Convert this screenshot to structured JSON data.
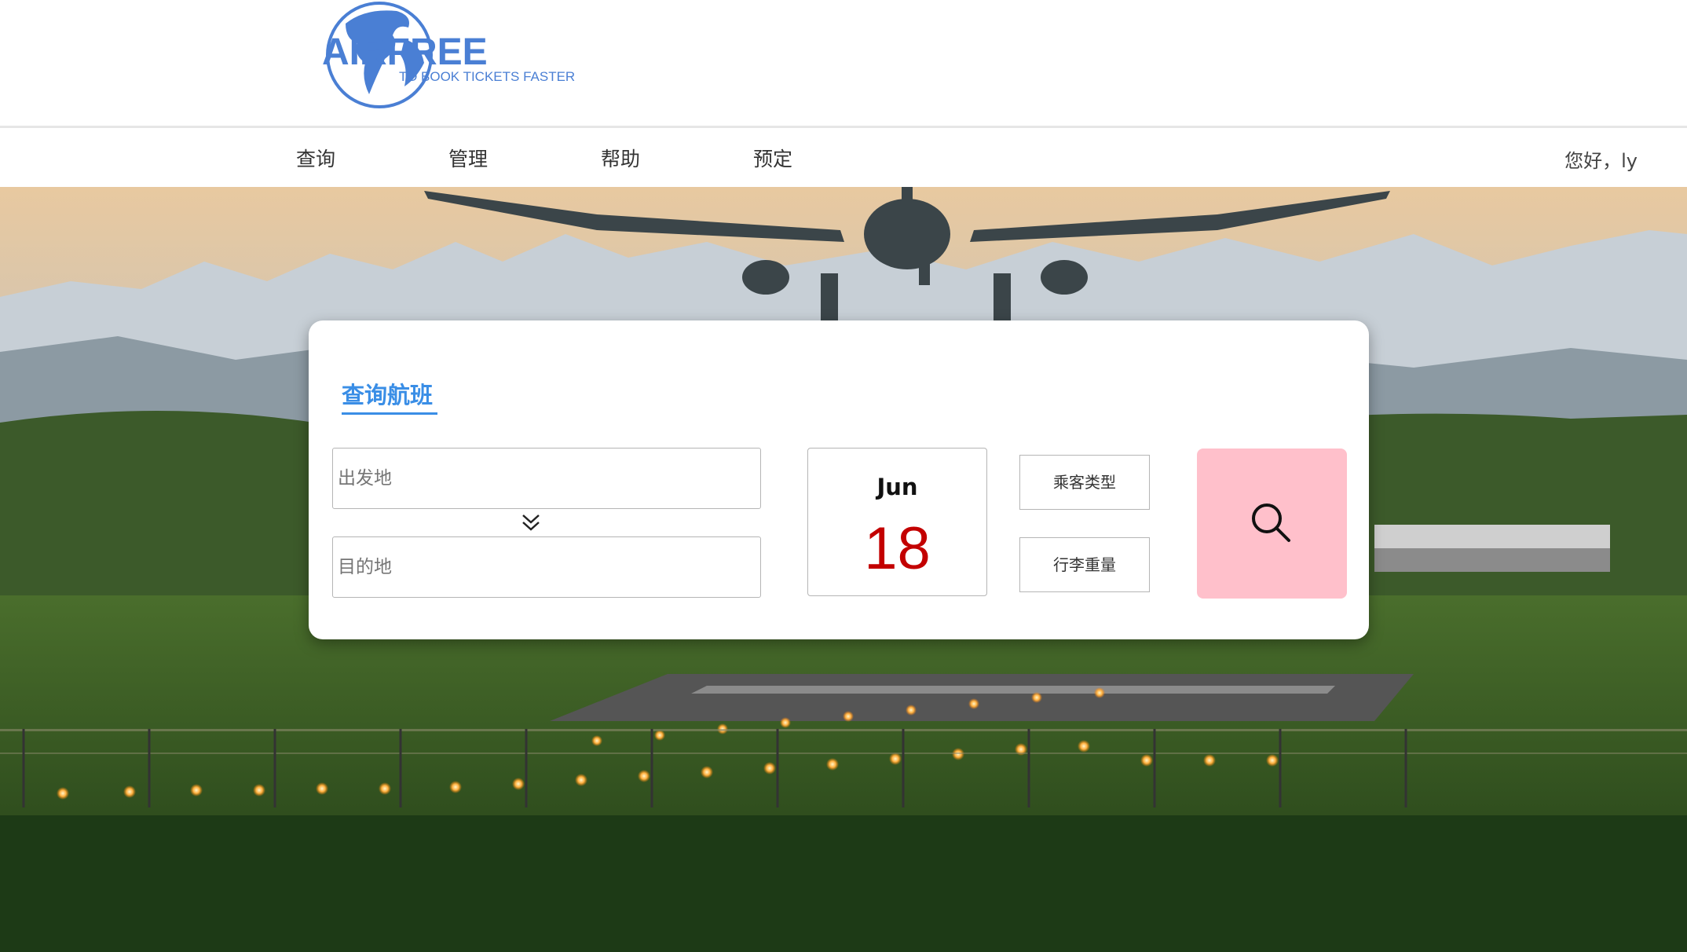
{
  "logo": {
    "brand": "AIRFREE",
    "tagline": "TO BOOK TICKETS FASTER"
  },
  "nav": {
    "items": [
      "查询",
      "管理",
      "帮助",
      "预定"
    ],
    "greeting": "您好，ly"
  },
  "search_card": {
    "title": "查询航班",
    "origin_placeholder": "出发地",
    "destination_placeholder": "目的地",
    "date": {
      "month": "Jun",
      "day": "18"
    },
    "passenger_type_label": "乘客类型",
    "luggage_weight_label": "行李重量"
  },
  "icons": {
    "swap": "double-chevron-down-icon",
    "search": "search-icon"
  },
  "colors": {
    "accent": "#3a8ee6",
    "date_red": "#c30000",
    "search_bg": "#ffc0cb"
  }
}
